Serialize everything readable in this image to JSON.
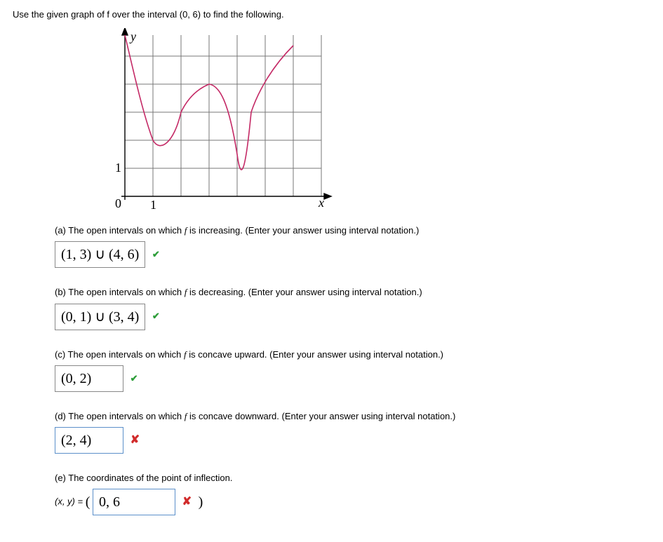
{
  "prompt": "Use the given graph of f over the interval (0, 6) to find the following.",
  "graph": {
    "ylabel": "y",
    "xlabel": "x",
    "xtick": "1",
    "ytick": "1",
    "origin": "0"
  },
  "parts": {
    "a": {
      "text_prefix": "(a) The open intervals on which ",
      "text_mid": "f",
      "text_suffix": " is increasing. (Enter your answer using interval notation.)",
      "answer": "(1, 3) ∪ (4, 6)",
      "correct": true
    },
    "b": {
      "text_prefix": "(b) The open intervals on which ",
      "text_mid": "f",
      "text_suffix": " is decreasing. (Enter your answer using interval notation.)",
      "answer": "(0, 1) ∪ (3, 4)",
      "correct": true
    },
    "c": {
      "text_prefix": "(c) The open intervals on which ",
      "text_mid": "f",
      "text_suffix": " is concave upward. (Enter your answer using interval notation.)",
      "answer": "(0, 2)",
      "correct": true
    },
    "d": {
      "text_prefix": "(d) The open intervals on which ",
      "text_mid": "f",
      "text_suffix": " is concave downward. (Enter your answer using interval notation.)",
      "answer": "(2, 4)",
      "correct": false
    },
    "e": {
      "text": "(e) The coordinates of the point of inflection.",
      "xy_label": "(x, y) = ",
      "paren_open": "(",
      "paren_close": ")",
      "answer": "0, 6",
      "correct": false
    }
  },
  "marks": {
    "check": "✔",
    "cross": "✘"
  },
  "chart_data": {
    "type": "line",
    "title": "",
    "xlabel": "x",
    "ylabel": "y",
    "xlim": [
      0,
      6
    ],
    "ylim": [
      0,
      6
    ],
    "x_ticks": [
      1
    ],
    "y_ticks": [
      1
    ],
    "series": [
      {
        "name": "f",
        "points": [
          {
            "x": 0.0,
            "y": 6.0
          },
          {
            "x": 0.5,
            "y": 3.8
          },
          {
            "x": 1.0,
            "y": 2.0
          },
          {
            "x": 1.5,
            "y": 2.2
          },
          {
            "x": 2.0,
            "y": 3.0
          },
          {
            "x": 2.5,
            "y": 3.7
          },
          {
            "x": 3.0,
            "y": 4.0
          },
          {
            "x": 3.5,
            "y": 3.0
          },
          {
            "x": 4.0,
            "y": 0.5
          },
          {
            "x": 4.5,
            "y": 3.0
          },
          {
            "x": 5.0,
            "y": 4.3
          },
          {
            "x": 5.5,
            "y": 5.3
          },
          {
            "x": 6.0,
            "y": 6.0
          }
        ]
      }
    ]
  }
}
